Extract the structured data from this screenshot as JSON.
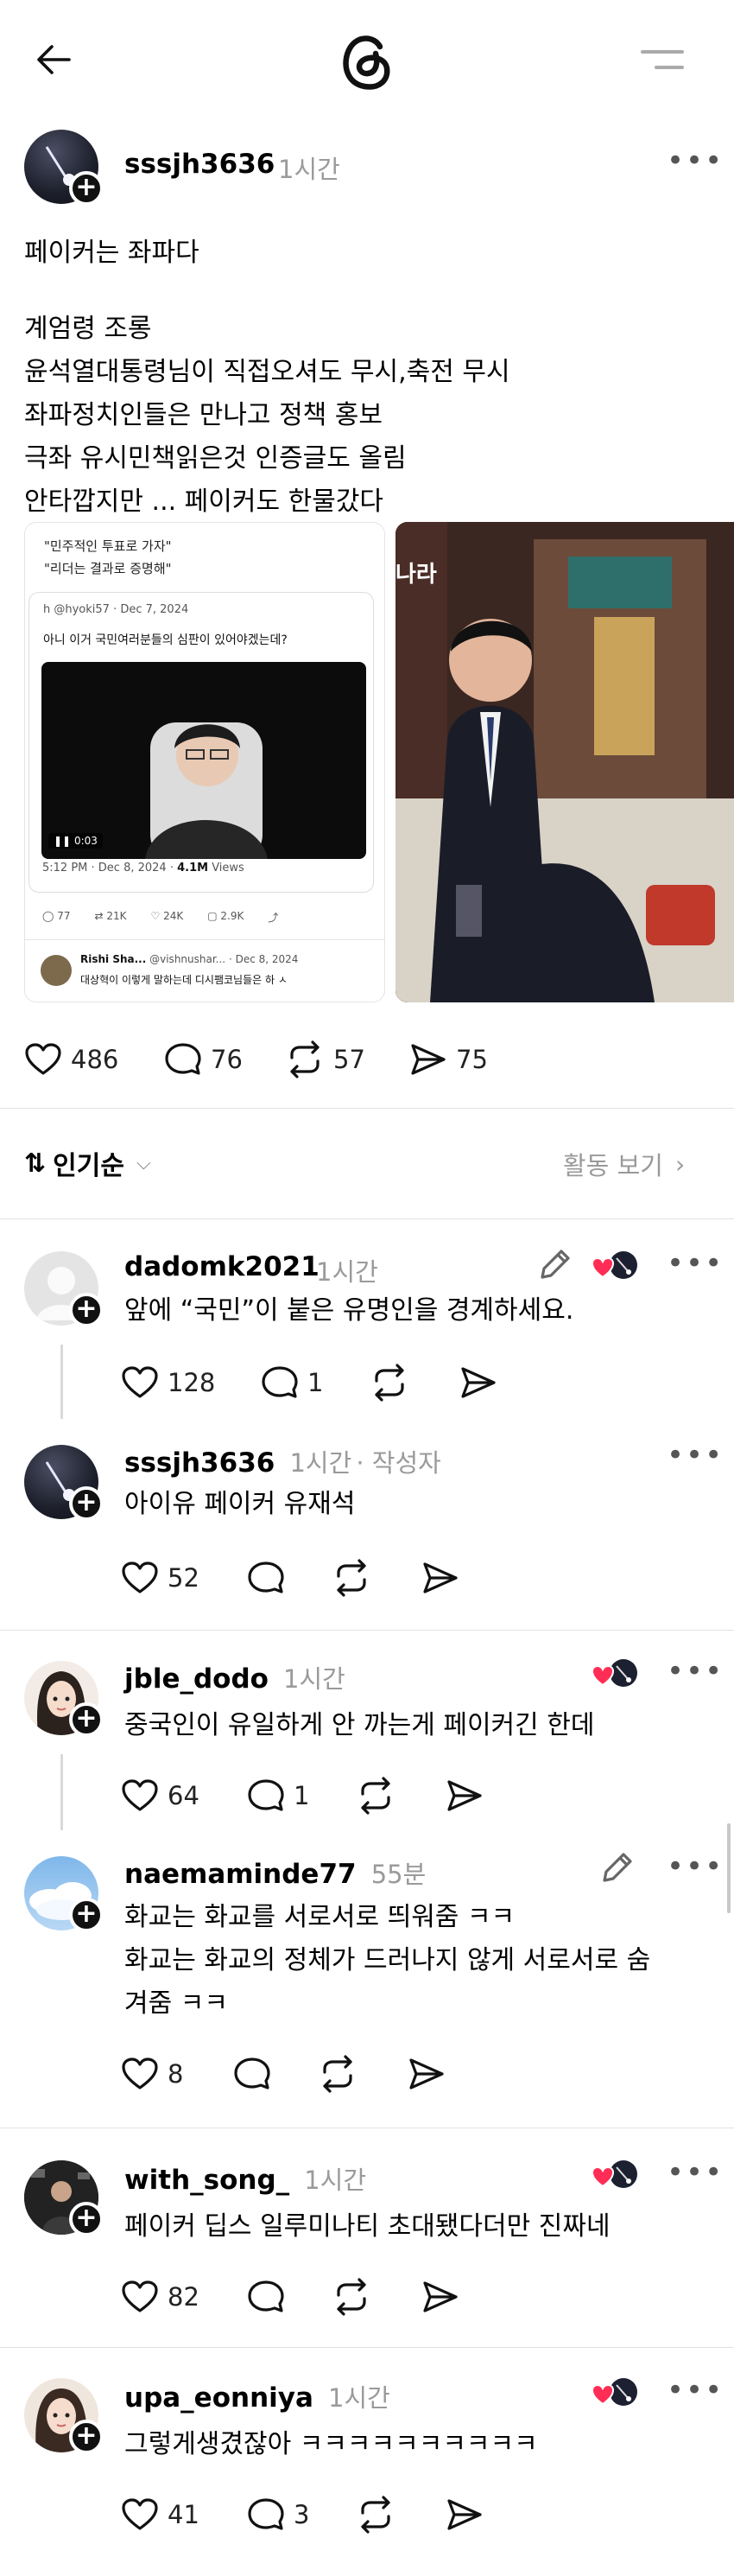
{
  "header": {
    "back": "back-arrow",
    "logo": "threads-logo",
    "menu": "menu"
  },
  "post": {
    "username": "sssjh3636",
    "time": "1시간",
    "lines": [
      "페이커는 좌파다",
      "",
      "계엄령 조롱",
      "윤석열대통령님이 직접오셔도 무시,축전 무시",
      "좌파정치인들은 만나고 정책 홍보",
      "극좌 유시민책읽은것 인증글도 올림",
      "안타깝지만 ... 페이커도 한물갔다"
    ],
    "embed": {
      "quote_line1": "\"민주적인 투표로 가자\"",
      "quote_line2": "\"리더는 결과로 증명해\"",
      "inner_user": "h @hyoki57 · Dec 7, 2024",
      "inner_text": "아니 이거 국민여러분들의 심판이 있어야겠는데?",
      "video_time": "0:03",
      "meta": "5:12 PM · Dec 8, 2024 · ",
      "views": "4.1M",
      "views_label": " Views",
      "stats": [
        "77",
        "21K",
        "24K",
        "2.9K"
      ],
      "reply_user": "Rishi Sha...",
      "reply_handle": "@vishnushar...",
      "reply_date": "· Dec 8, 2024",
      "reply_text": "대상혁이 이렇게 말하는데 디시팸코님들은 하 ㅅ"
    },
    "stats": {
      "likes": "486",
      "replies": "76",
      "reposts": "57",
      "shares": "75"
    }
  },
  "sort": {
    "label": "인기순",
    "activity": "활동 보기"
  },
  "comments": [
    {
      "username": "dadomk2021",
      "time": "1시간",
      "author_tag": "",
      "text": [
        "앞에 “국민”이 붙은 유명인을 경계하세요."
      ],
      "likes": "128",
      "replies": "1"
    },
    {
      "username": "sssjh3636",
      "time": "1시간",
      "author_tag": "· 작성자",
      "text": [
        "아이유 페이커 유재석"
      ],
      "likes": "52",
      "replies": ""
    },
    {
      "username": "jble_dodo",
      "time": "1시간",
      "author_tag": "",
      "text": [
        "중국인이 유일하게 안 까는게 페이커긴 한데"
      ],
      "likes": "64",
      "replies": "1"
    },
    {
      "username": "naemaminde77",
      "time": "55분",
      "author_tag": "",
      "text": [
        "화교는 화교를 서로서로 띄워줌 ㅋㅋ",
        "화교는 화교의 정체가 드러나지 않게 서로서로 숨",
        "겨줌 ㅋㅋ"
      ],
      "likes": "8",
      "replies": ""
    },
    {
      "username": "with_song_",
      "time": "1시간",
      "author_tag": "",
      "text": [
        "페이커 딥스 일루미나티 초대됐다더만 진짜네"
      ],
      "likes": "82",
      "replies": ""
    },
    {
      "username": "upa_eonniya",
      "time": "1시간",
      "author_tag": "",
      "text": [
        "그렇게생겼잖아 ㅋㅋㅋㅋㅋㅋㅋㅋㅋㅋ"
      ],
      "likes": "41",
      "replies": "3"
    }
  ]
}
